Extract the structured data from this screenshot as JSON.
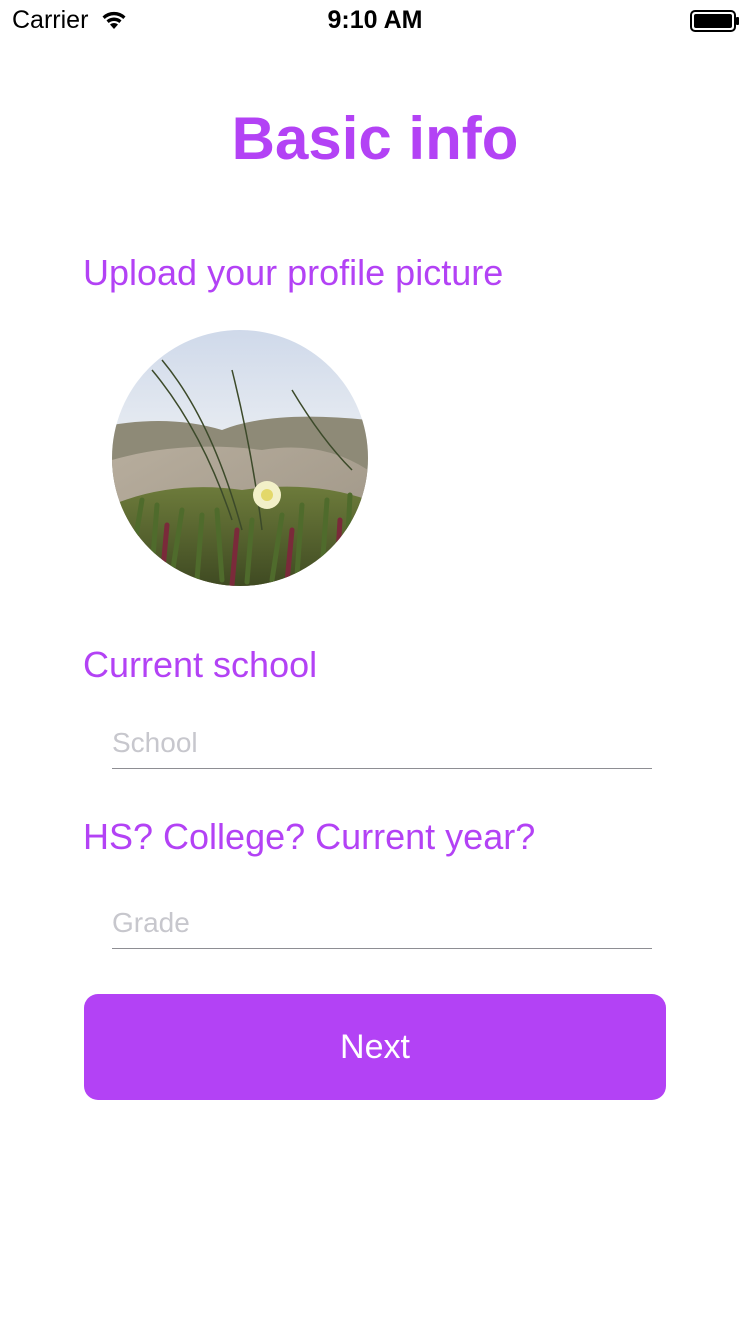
{
  "status_bar": {
    "carrier": "Carrier",
    "time": "9:10 AM"
  },
  "page": {
    "title": "Basic info"
  },
  "profile": {
    "upload_label": "Upload your profile picture",
    "avatar_icon": "profile-photo"
  },
  "school": {
    "label": "Current school",
    "placeholder": "School",
    "value": ""
  },
  "grade": {
    "label": "HS? College? Current year?",
    "placeholder": "Grade",
    "value": ""
  },
  "actions": {
    "next_label": "Next"
  },
  "colors": {
    "accent": "#b342f5",
    "background": "#ffffff",
    "placeholder": "#c7c7cd",
    "divider": "#8e8e93"
  }
}
